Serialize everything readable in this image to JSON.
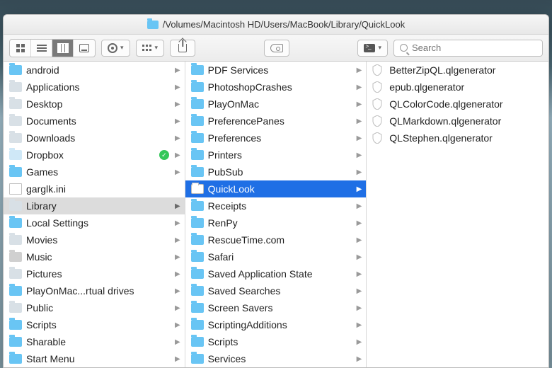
{
  "title_path": "/Volumes/Macintosh HD/Users/MacBook/Library/QuickLook",
  "search": {
    "placeholder": "Search"
  },
  "columns": [
    {
      "items": [
        {
          "label": "android",
          "icon": "folder",
          "arrow": true
        },
        {
          "label": "Applications",
          "icon": "folder-sys",
          "arrow": true
        },
        {
          "label": "Desktop",
          "icon": "folder-sys",
          "arrow": true
        },
        {
          "label": "Documents",
          "icon": "folder-sys",
          "arrow": true
        },
        {
          "label": "Downloads",
          "icon": "folder-sys",
          "arrow": true
        },
        {
          "label": "Dropbox",
          "icon": "folder-db",
          "arrow": true,
          "badge": "ok"
        },
        {
          "label": "Games",
          "icon": "folder",
          "arrow": true
        },
        {
          "label": "garglk.ini",
          "icon": "file",
          "arrow": false
        },
        {
          "label": "Library",
          "icon": "folder-sys",
          "arrow": true,
          "selected": "soft"
        },
        {
          "label": "Local Settings",
          "icon": "folder",
          "arrow": true
        },
        {
          "label": "Movies",
          "icon": "folder-sys",
          "arrow": true
        },
        {
          "label": "Music",
          "icon": "folder-mus",
          "arrow": true
        },
        {
          "label": "Pictures",
          "icon": "folder-sys",
          "arrow": true
        },
        {
          "label": "PlayOnMac...rtual drives",
          "icon": "folder",
          "arrow": true
        },
        {
          "label": "Public",
          "icon": "folder-sys",
          "arrow": true
        },
        {
          "label": "Scripts",
          "icon": "folder",
          "arrow": true
        },
        {
          "label": "Sharable",
          "icon": "folder",
          "arrow": true
        },
        {
          "label": "Start Menu",
          "icon": "folder",
          "arrow": true
        }
      ]
    },
    {
      "items": [
        {
          "label": "PDF Services",
          "icon": "folder",
          "arrow": true
        },
        {
          "label": "PhotoshopCrashes",
          "icon": "folder",
          "arrow": true
        },
        {
          "label": "PlayOnMac",
          "icon": "folder",
          "arrow": true
        },
        {
          "label": "PreferencePanes",
          "icon": "folder",
          "arrow": true
        },
        {
          "label": "Preferences",
          "icon": "folder",
          "arrow": true
        },
        {
          "label": "Printers",
          "icon": "folder",
          "arrow": true
        },
        {
          "label": "PubSub",
          "icon": "folder",
          "arrow": true
        },
        {
          "label": "QuickLook",
          "icon": "folder-white",
          "arrow": true,
          "selected": "hard"
        },
        {
          "label": "Receipts",
          "icon": "folder",
          "arrow": true
        },
        {
          "label": "RenPy",
          "icon": "folder",
          "arrow": true
        },
        {
          "label": "RescueTime.com",
          "icon": "folder",
          "arrow": true
        },
        {
          "label": "Safari",
          "icon": "folder",
          "arrow": true
        },
        {
          "label": "Saved Application State",
          "icon": "folder",
          "arrow": true
        },
        {
          "label": "Saved Searches",
          "icon": "folder",
          "arrow": true
        },
        {
          "label": "Screen Savers",
          "icon": "folder",
          "arrow": true
        },
        {
          "label": "ScriptingAdditions",
          "icon": "folder",
          "arrow": true
        },
        {
          "label": "Scripts",
          "icon": "folder",
          "arrow": true
        },
        {
          "label": "Services",
          "icon": "folder",
          "arrow": true
        }
      ]
    },
    {
      "items": [
        {
          "label": "BetterZipQL.qlgenerator",
          "icon": "shield",
          "arrow": false
        },
        {
          "label": "epub.qlgenerator",
          "icon": "shield",
          "arrow": false
        },
        {
          "label": "QLColorCode.qlgenerator",
          "icon": "shield",
          "arrow": false
        },
        {
          "label": "QLMarkdown.qlgenerator",
          "icon": "shield",
          "arrow": false
        },
        {
          "label": "QLStephen.qlgenerator",
          "icon": "shield",
          "arrow": false
        }
      ]
    }
  ]
}
